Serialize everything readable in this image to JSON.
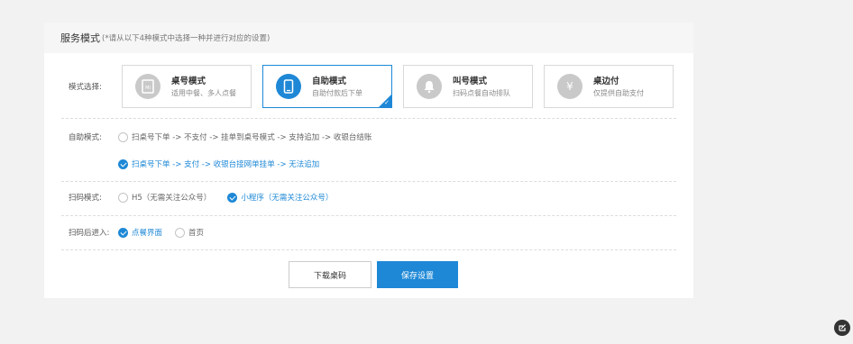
{
  "panel": {
    "title": "服务模式",
    "note": "(*请从以下4种模式中选择一种并进行对应的设置)"
  },
  "mode": {
    "label": "模式选择:",
    "cards": [
      {
        "title": "桌号模式",
        "desc": "适用中餐、多人点餐",
        "icon": "table-card-icon",
        "selected": false
      },
      {
        "title": "自助模式",
        "desc": "自助付款后下单",
        "icon": "phone-icon",
        "selected": true
      },
      {
        "title": "叫号模式",
        "desc": "扫码点餐自动排队",
        "icon": "bell-icon",
        "selected": false
      },
      {
        "title": "桌边付",
        "desc": "仅提供自助支付",
        "icon": "yen-icon",
        "selected": false
      }
    ]
  },
  "self_service": {
    "label": "自助模式:",
    "options": [
      {
        "text": "扫桌号下单 -> 不支付 -> 挂单到桌号模式 -> 支持追加 -> 收银台结账",
        "checked": false
      },
      {
        "text": "扫桌号下单 -> 支付 -> 收银台接网单挂单 -> 无法追加",
        "checked": true
      }
    ]
  },
  "scan_mode": {
    "label": "扫码模式:",
    "options": [
      {
        "text": "H5（无需关注公众号）",
        "checked": false
      },
      {
        "text": "小程序（无需关注公众号）",
        "checked": true
      }
    ]
  },
  "after_scan": {
    "label": "扫码后进入:",
    "options": [
      {
        "text": "点餐界面",
        "checked": true
      },
      {
        "text": "首页",
        "checked": false
      }
    ]
  },
  "buttons": {
    "download": "下载桌码",
    "save": "保存设置"
  },
  "colors": {
    "accent": "#1e88d6",
    "background": "#f2f2f2"
  }
}
